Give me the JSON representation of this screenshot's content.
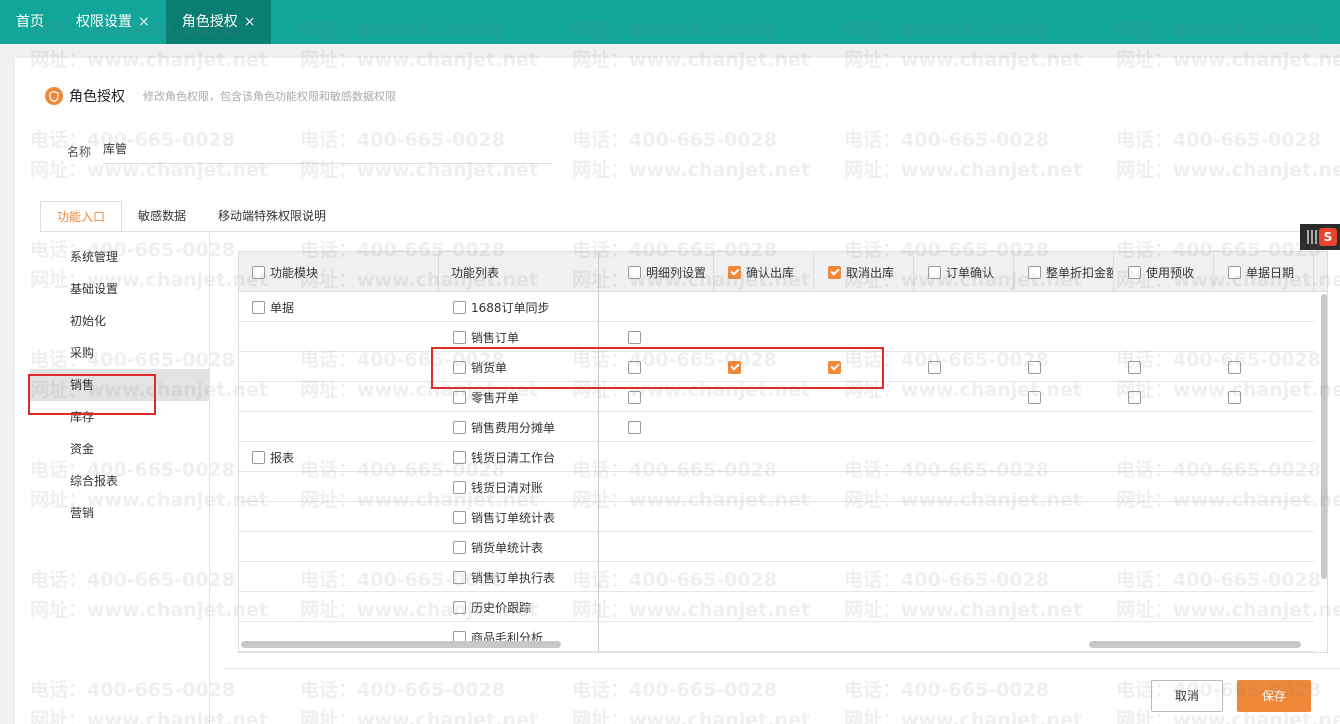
{
  "top_tabs": [
    {
      "label": "首页",
      "closable": false,
      "active": false
    },
    {
      "label": "权限设置",
      "closable": true,
      "active": false
    },
    {
      "label": "角色授权",
      "closable": true,
      "active": true
    }
  ],
  "close_glyph": "×",
  "page": {
    "title": "角色授权",
    "subtitle": "修改角色权限，包含该角色功能权限和敏感数据权限",
    "name_label": "名称",
    "name_value": "库管"
  },
  "tabs": [
    "功能入口",
    "敏感数据",
    "移动端特殊权限说明"
  ],
  "left_nav": [
    "系统管理",
    "基础设置",
    "初始化",
    "采购",
    "销售",
    "库存",
    "资金",
    "综合报表",
    "营销"
  ],
  "left_nav_active": 4,
  "table": {
    "col_module": "功能模块",
    "col_list": "功能列表",
    "perm_columns": [
      {
        "label": "明细列设置",
        "checked": false
      },
      {
        "label": "确认出库",
        "checked": true
      },
      {
        "label": "取消出库",
        "checked": true
      },
      {
        "label": "订单确认",
        "checked": false
      },
      {
        "label": "整单折扣金额",
        "checked": false
      },
      {
        "label": "使用预收",
        "checked": false
      },
      {
        "label": "单据日期",
        "checked": false
      }
    ],
    "rows": [
      {
        "module": "单据",
        "func": "1688订单同步",
        "cells": [
          null,
          null,
          null,
          null,
          null,
          null,
          null
        ]
      },
      {
        "module": "",
        "func": "销售订单",
        "cells": [
          false,
          null,
          null,
          null,
          null,
          null,
          null
        ]
      },
      {
        "module": "",
        "func": "销货单",
        "cells": [
          false,
          true,
          true,
          false,
          false,
          false,
          false
        ]
      },
      {
        "module": "",
        "func": "零售开单",
        "cells": [
          false,
          null,
          null,
          null,
          false,
          false,
          false
        ]
      },
      {
        "module": "",
        "func": "销售费用分摊单",
        "cells": [
          false,
          null,
          null,
          null,
          null,
          null,
          null
        ]
      },
      {
        "module": "报表",
        "func": "钱货日清工作台",
        "cells": [
          null,
          null,
          null,
          null,
          null,
          null,
          null
        ]
      },
      {
        "module": "",
        "func": "钱货日清对账",
        "cells": [
          null,
          null,
          null,
          null,
          null,
          null,
          null
        ]
      },
      {
        "module": "",
        "func": "销售订单统计表",
        "cells": [
          null,
          null,
          null,
          null,
          null,
          null,
          null
        ]
      },
      {
        "module": "",
        "func": "销货单统计表",
        "cells": [
          null,
          null,
          null,
          null,
          null,
          null,
          null
        ]
      },
      {
        "module": "",
        "func": "销售订单执行表",
        "cells": [
          null,
          null,
          null,
          null,
          null,
          null,
          null
        ]
      },
      {
        "module": "",
        "func": "历史价跟踪",
        "cells": [
          null,
          null,
          null,
          null,
          null,
          null,
          null
        ]
      },
      {
        "module": "",
        "func": "商品毛利分析",
        "cells": [
          null,
          null,
          null,
          null,
          null,
          null,
          null
        ]
      }
    ]
  },
  "buttons": {
    "cancel": "取消",
    "save": "保存"
  },
  "watermark": {
    "phone": "电话：400-665-0028",
    "site": "网址：www.chanjet.net"
  },
  "ime_letter": "S",
  "colors": {
    "teal": "#12a69a",
    "teal_active": "#0b7e73",
    "accent": "#f0883a",
    "highlight": "#e02a2a"
  }
}
